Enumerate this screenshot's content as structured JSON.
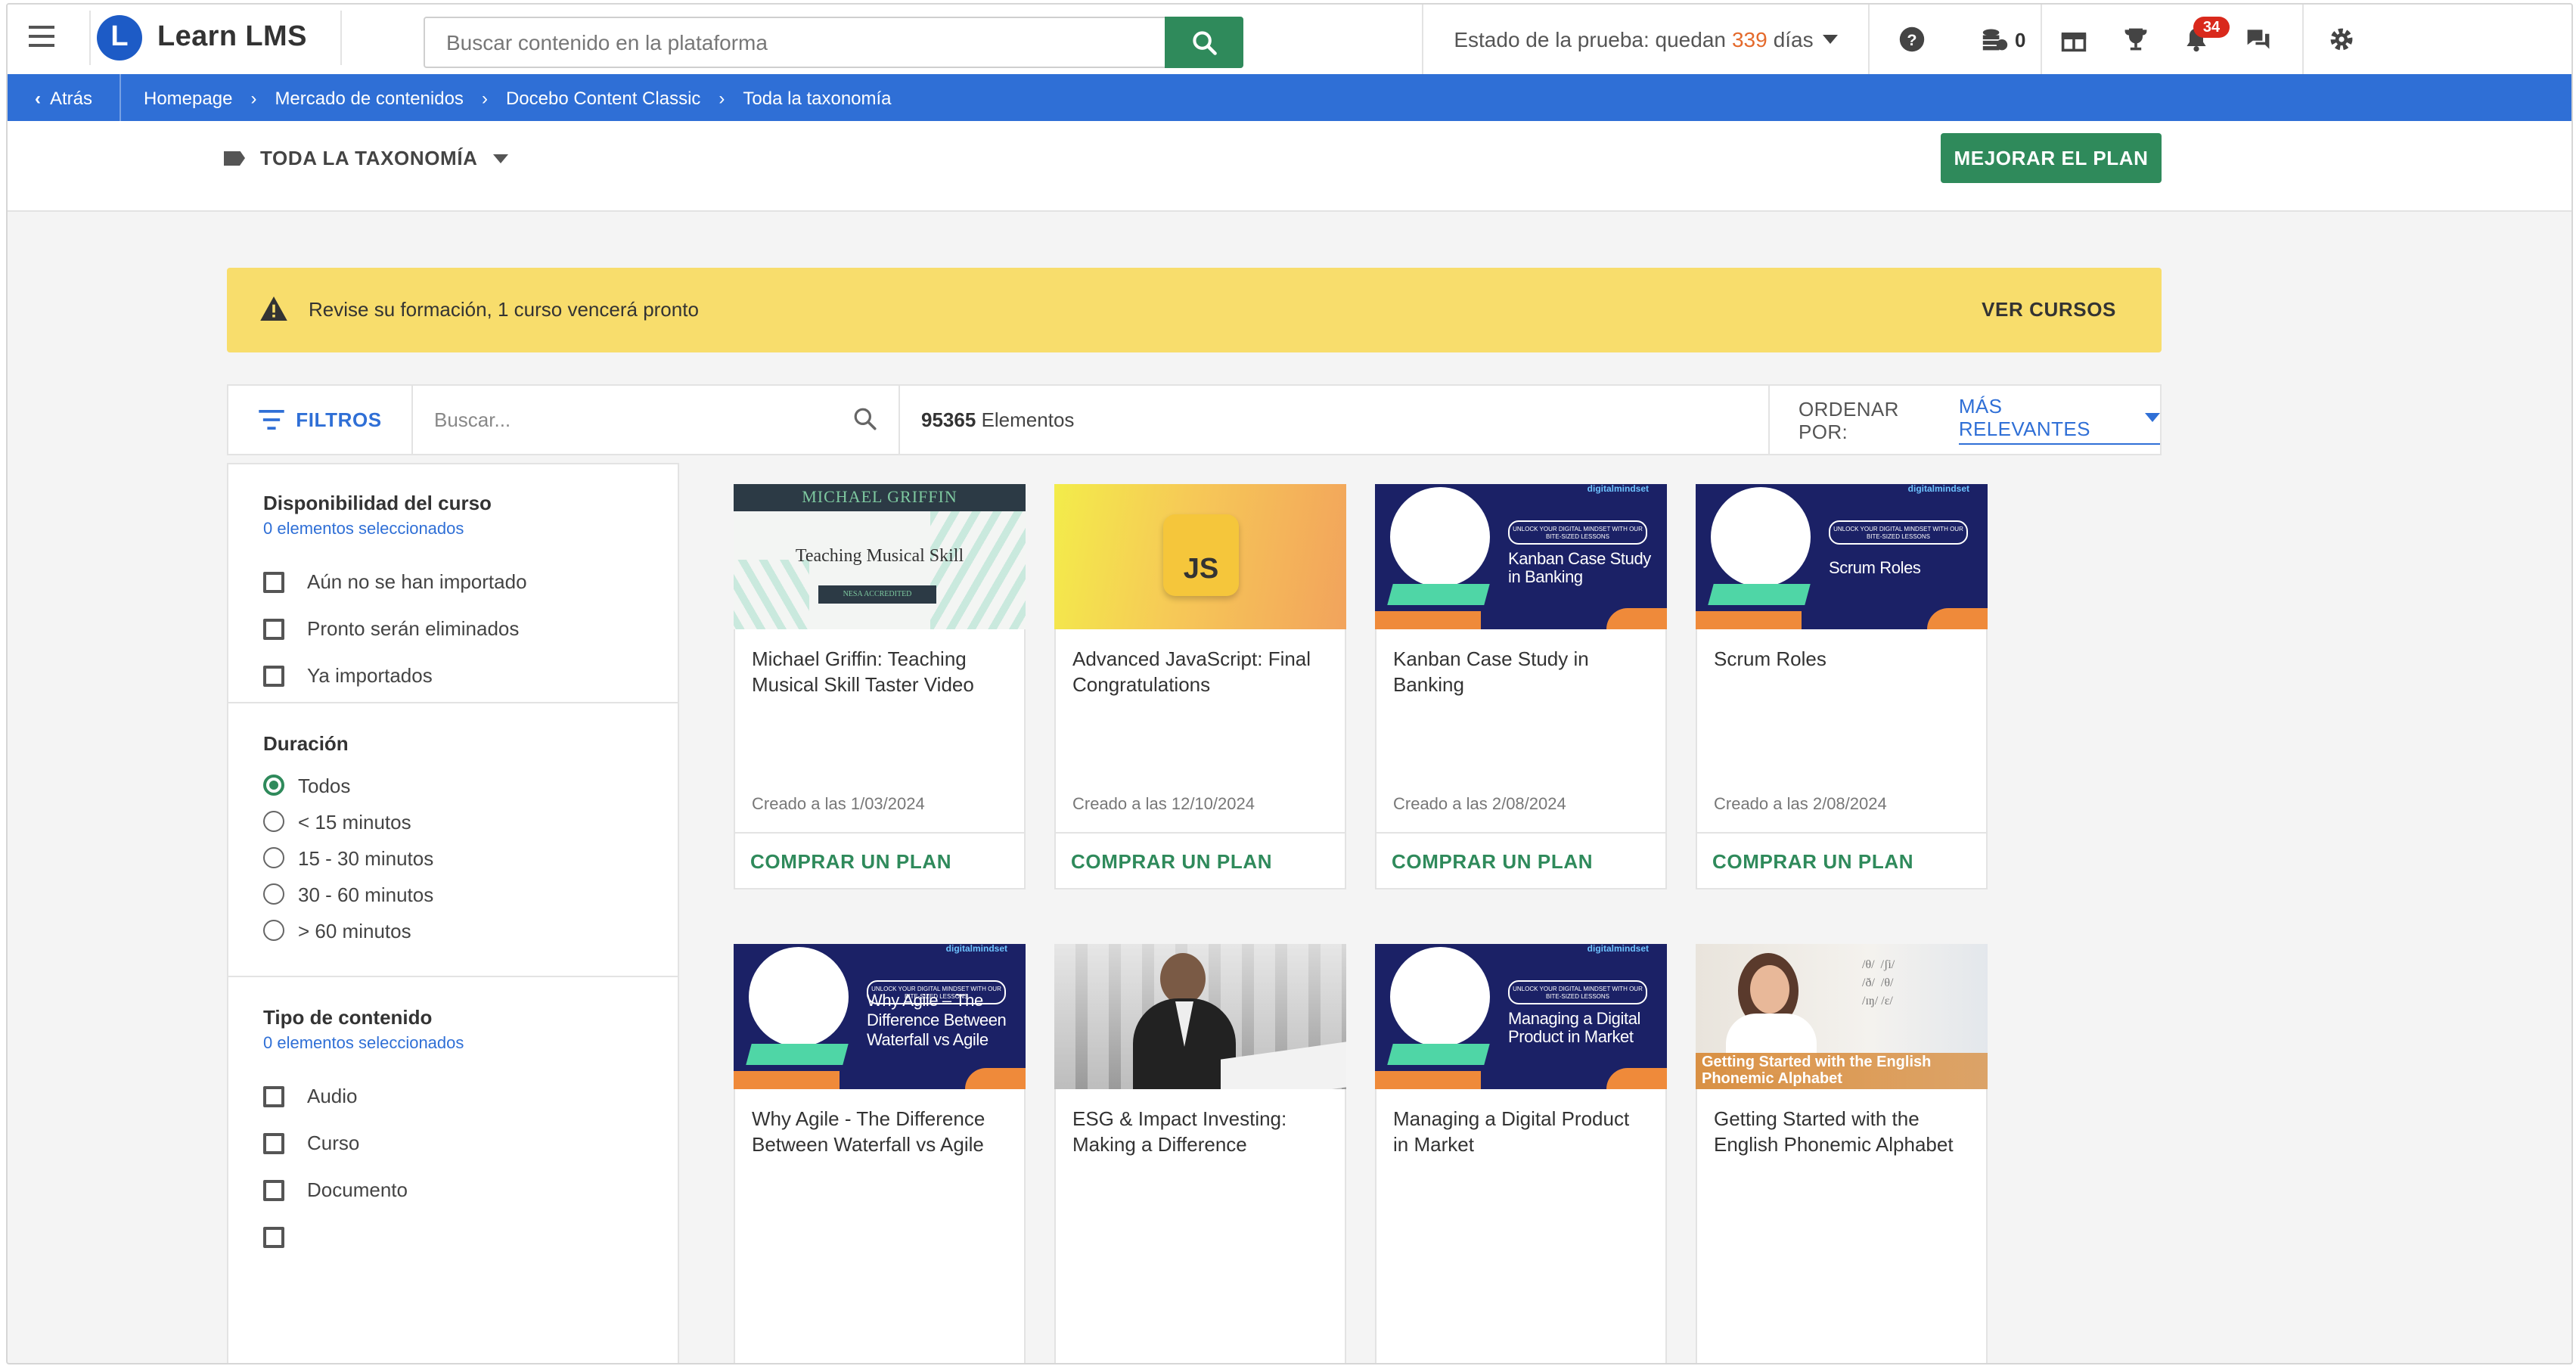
{
  "app": {
    "name": "Learn LMS",
    "logo_letter": "L"
  },
  "topbar": {
    "search_placeholder": "Buscar contenido en la plataforma",
    "trial_prefix": "Estado de la prueba: quedan",
    "trial_days": "339",
    "trial_suffix": "días",
    "coins": "0",
    "notifications_count": "34",
    "accent_color": "#2f8a5b"
  },
  "breadcrumb": {
    "back_label": "Atrás",
    "items": [
      "Homepage",
      "Mercado de contenidos",
      "Docebo Content Classic",
      "Toda la taxonomía"
    ]
  },
  "subheader": {
    "taxonomy_label": "TODA LA TAXONOMÍA",
    "upgrade_label": "MEJORAR EL PLAN"
  },
  "banner": {
    "message": "Revise su formación, 1 curso vencerá pronto",
    "action": "VER CURSOS"
  },
  "toolbar": {
    "filters_label": "FILTROS",
    "search_placeholder": "Buscar...",
    "count": "95365",
    "count_label": "Elementos",
    "sort_label": "ORDENAR POR:",
    "sort_value": "MÁS RELEVANTES"
  },
  "filters": {
    "availability": {
      "title": "Disponibilidad del curso",
      "selected": "0 elementos seleccionados",
      "options": [
        "Aún no se han importado",
        "Pronto serán eliminados",
        "Ya importados"
      ]
    },
    "duration": {
      "title": "Duración",
      "options": [
        "Todos",
        "< 15 minutos",
        "15 - 30 minutos",
        "30 - 60 minutos",
        "> 60 minutos"
      ],
      "selected_option": "Todos"
    },
    "content_type": {
      "title": "Tipo de contenido",
      "selected": "0 elementos seleccionados",
      "options": [
        "Audio",
        "Curso",
        "Documento"
      ]
    }
  },
  "cards": [
    {
      "title": "Michael Griffin: Teaching Musical Skill Taster Video",
      "date": "Creado a las 1/03/2024",
      "action": "COMPRAR UN PLAN",
      "thumb": {
        "top_text": "MICHAEL GRIFFIN",
        "main": "Teaching Musical Skill",
        "sub": "NESA ACCREDITED"
      }
    },
    {
      "title": "Advanced JavaScript: Final Congratulations",
      "date": "Creado a las 12/10/2024",
      "action": "COMPRAR UN PLAN",
      "thumb": {
        "main": "JS"
      }
    },
    {
      "title": "Kanban Case Study in Banking",
      "date": "Creado a las 2/08/2024",
      "action": "COMPRAR UN PLAN",
      "thumb": {
        "brand": "digitalmindset",
        "pill": "UNLOCK YOUR DIGITAL MINDSET WITH OUR BITE-SIZED LESSONS",
        "main": "Kanban Case Study in Banking"
      }
    },
    {
      "title": "Scrum Roles",
      "date": "Creado a las 2/08/2024",
      "action": "COMPRAR UN PLAN",
      "thumb": {
        "brand": "digitalmindset",
        "pill": "UNLOCK YOUR DIGITAL MINDSET WITH OUR BITE-SIZED LESSONS",
        "main": "Scrum Roles"
      }
    },
    {
      "title": "Why Agile - The Difference Between Waterfall vs Agile",
      "date": "",
      "action": "",
      "thumb": {
        "brand": "digitalmindset",
        "pill": "UNLOCK YOUR DIGITAL MINDSET WITH OUR BITE-SIZED LESSONS",
        "main": "Why Agile – The Difference Between Waterfall vs Agile"
      }
    },
    {
      "title": "ESG & Impact Investing: Making a Difference",
      "date": "",
      "action": "",
      "thumb": {}
    },
    {
      "title": "Managing a Digital Product in Market",
      "date": "",
      "action": "",
      "thumb": {
        "brand": "digitalmindset",
        "pill": "UNLOCK YOUR DIGITAL MINDSET WITH OUR BITE-SIZED LESSONS",
        "main": "Managing a Digital Product in Market"
      }
    },
    {
      "title": "Getting Started with the English Phonemic Alphabet",
      "date": "",
      "action": "",
      "thumb": {
        "main": "Getting Started with the English Phonemic Alphabet"
      }
    }
  ]
}
